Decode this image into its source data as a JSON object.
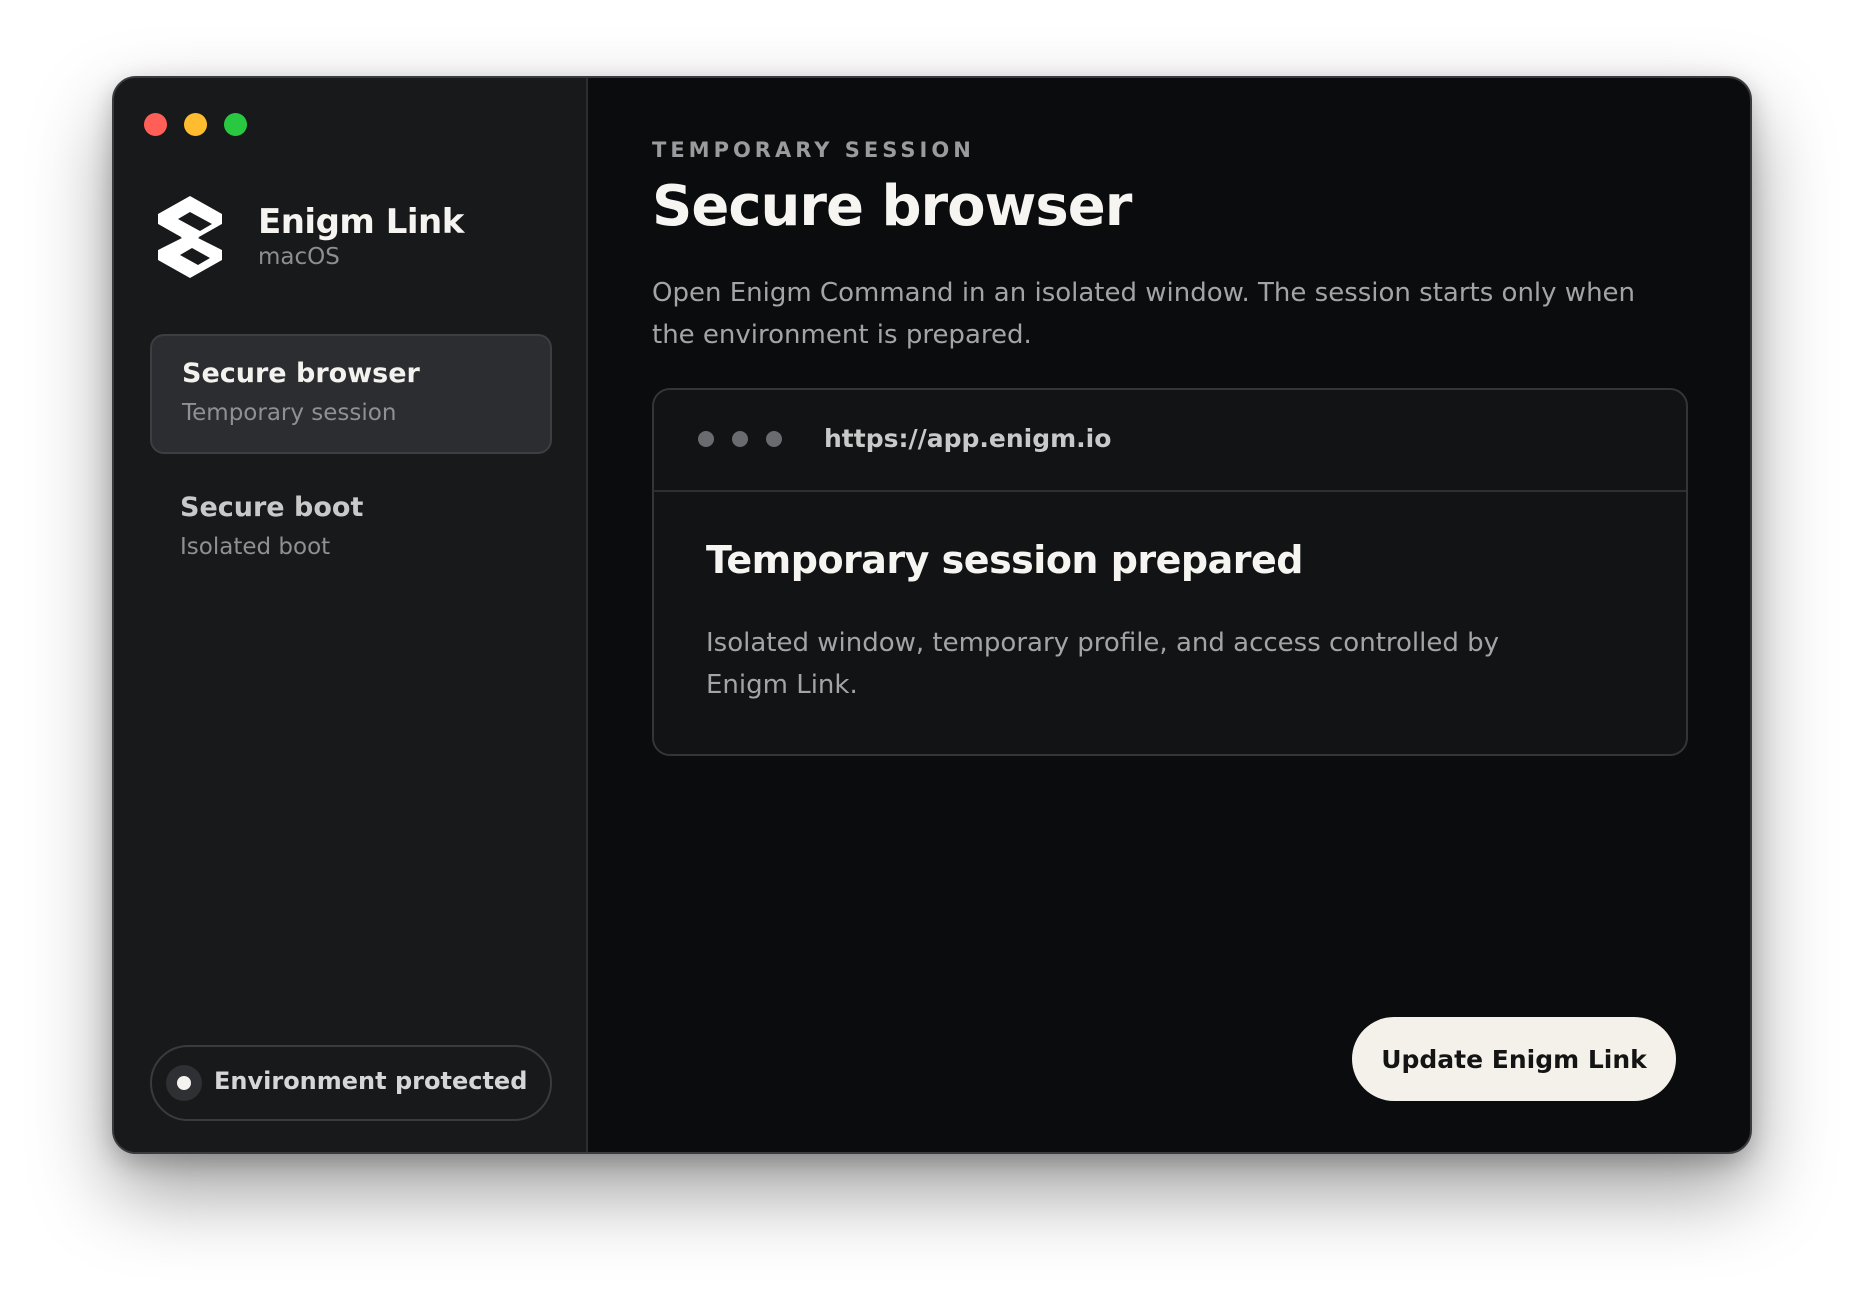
{
  "window": {
    "controls": [
      "close",
      "minimize",
      "zoom"
    ]
  },
  "brand": {
    "name": "Enigm Link",
    "platform": "macOS",
    "logo_icon": "enigm-logo-icon"
  },
  "sidebar": {
    "items": [
      {
        "title": "Secure browser",
        "subtitle": "Temporary session",
        "active": true
      },
      {
        "title": "Secure boot",
        "subtitle": "Isolated boot",
        "active": false
      }
    ],
    "status": {
      "label": "Environment protected",
      "icon": "status-dot-icon"
    }
  },
  "main": {
    "eyebrow": "TEMPORARY SESSION",
    "title": "Secure browser",
    "description": "Open Enigm Command in an isolated window. The session starts only when the environment is prepared.",
    "browser_card": {
      "url": "https://app.enigm.io",
      "title": "Temporary session prepared",
      "description": "Isolated window, temporary profile, and access controlled by Enigm Link."
    },
    "cta_label": "Update Enigm Link"
  },
  "colors": {
    "window_bg": "#0b0c0e",
    "sidebar_bg": "#18191b",
    "active_item_bg": "#2c2d30",
    "card_bg": "#121315",
    "cta_bg": "#f4f1ea",
    "text_primary": "#f6f5f1",
    "text_secondary": "#a3a4a7",
    "traffic_red": "#ff5f57",
    "traffic_yellow": "#febc2e",
    "traffic_green": "#28c840"
  }
}
